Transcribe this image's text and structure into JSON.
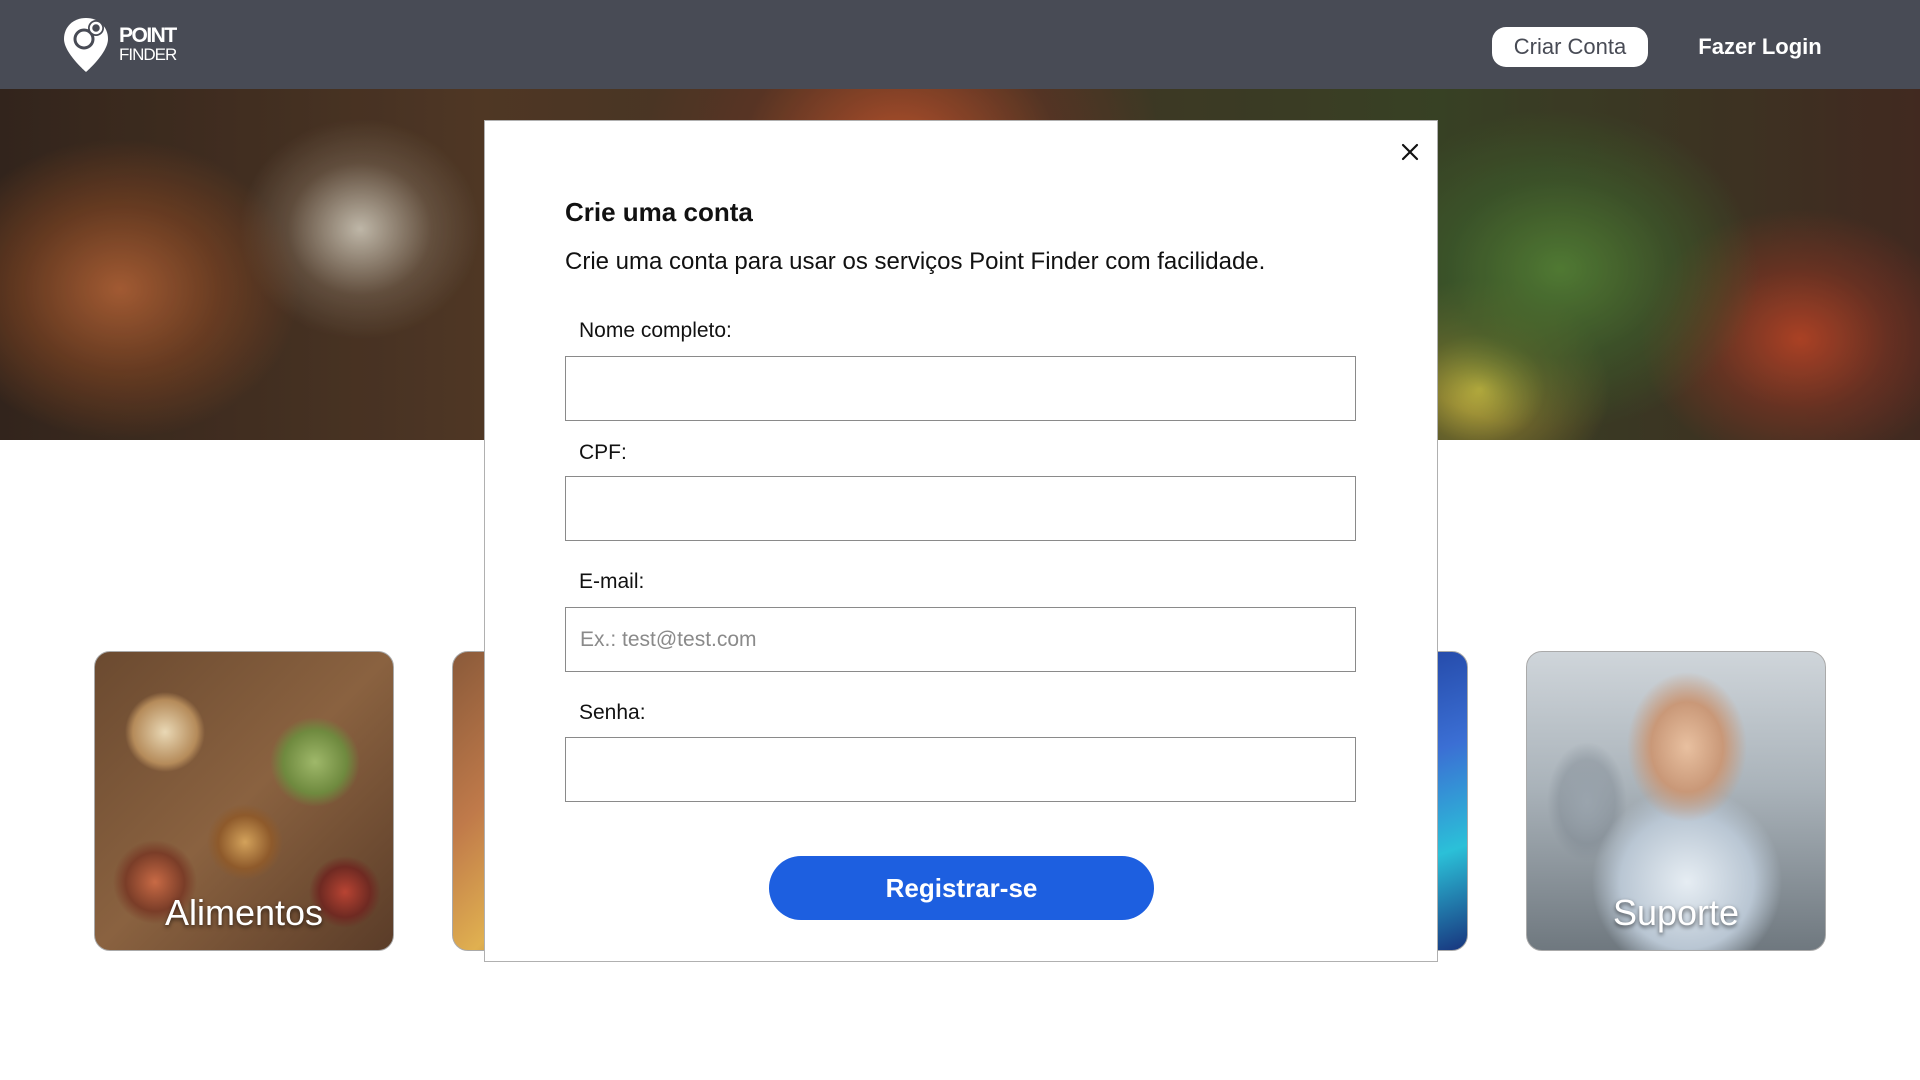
{
  "header": {
    "logo": {
      "line1": "POINT",
      "line2": "FINDER"
    },
    "create_account_label": "Criar Conta",
    "login_label": "Fazer Login"
  },
  "categories": [
    {
      "label": "Alimentos"
    },
    {
      "label": "Suporte"
    }
  ],
  "modal": {
    "title": "Crie uma conta",
    "subtitle": "Crie uma conta para usar os serviços Point Finder com facilidade.",
    "fields": [
      {
        "label": "Nome completo:",
        "value": "",
        "placeholder": ""
      },
      {
        "label": "CPF:",
        "value": "",
        "placeholder": ""
      },
      {
        "label": "E-mail:",
        "value": "",
        "placeholder": "Ex.: test@test.com"
      },
      {
        "label": "Senha:",
        "value": "",
        "placeholder": ""
      }
    ],
    "submit_label": "Registrar-se"
  },
  "colors": {
    "header_bg": "#484b55",
    "primary_button": "#1d5fe0"
  },
  "icons": {
    "logo": "map-pin-icon",
    "close": "close-icon"
  }
}
